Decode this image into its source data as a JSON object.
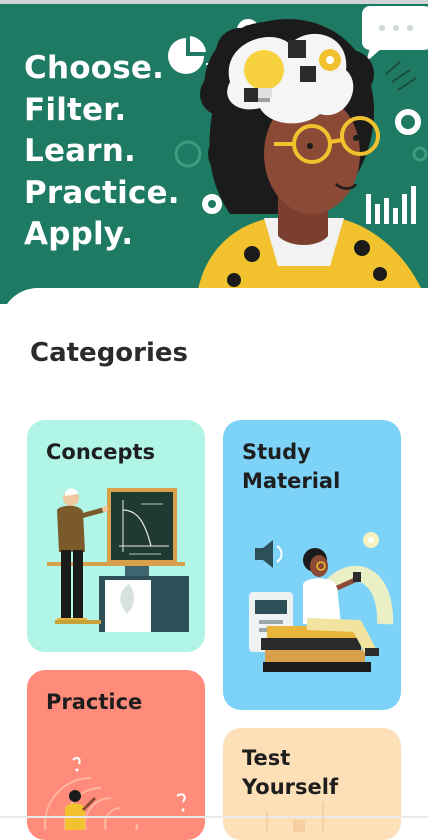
{
  "hero": {
    "lines": [
      "Choose.",
      "Filter.",
      "Learn.",
      "Practice.",
      "Apply."
    ],
    "bg_color": "#1f7a63"
  },
  "categories": {
    "title": "Categories",
    "cards": [
      {
        "label": "Concepts",
        "color": "#b0f5e6",
        "illustration": "teacher-at-blackboard-illustration"
      },
      {
        "label": "Study Material",
        "color": "#7dd3f7",
        "illustration": "student-reading-books-illustration"
      },
      {
        "label": "Practice",
        "color": "#ff8c7a",
        "illustration": "person-solving-maze-illustration"
      },
      {
        "label": "Test Yourself",
        "color": "#fde0b8",
        "illustration": "test-illustration"
      }
    ]
  }
}
